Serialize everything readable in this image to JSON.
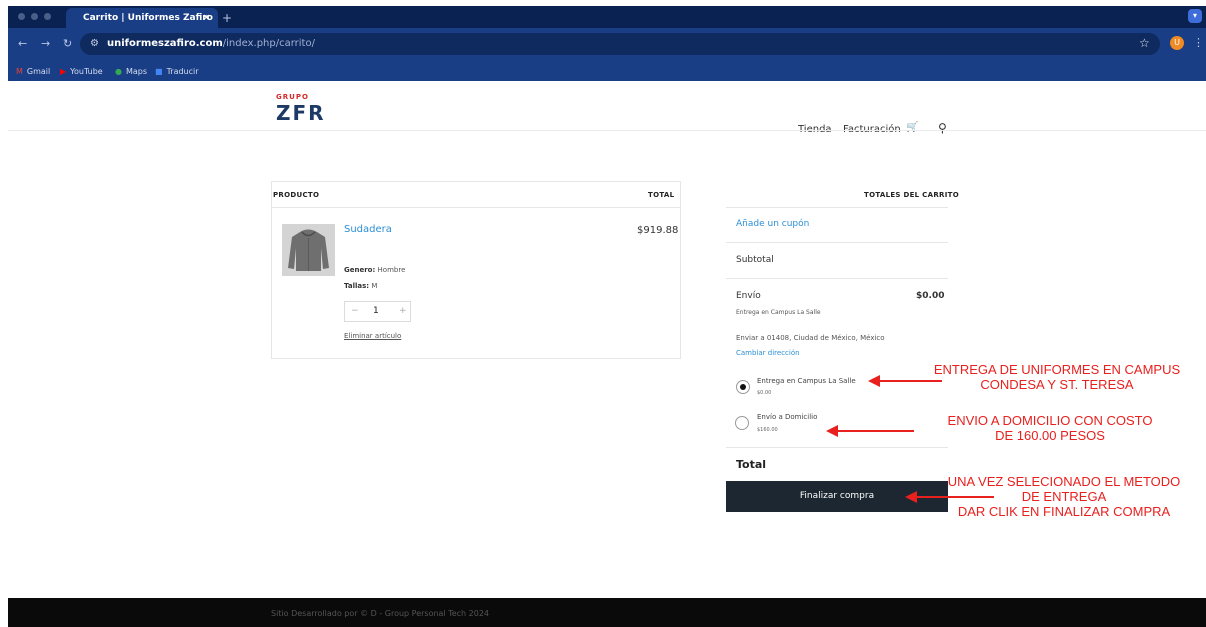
{
  "browser": {
    "tab_title": "Carrito | Uniformes Zafiro",
    "tab_close": "×",
    "new_tab": "+",
    "url_host": "uniformeszafiro.com",
    "url_path": "/index.php/carrito/",
    "profile_initial": "U",
    "bookmarks": [
      {
        "label": "Gmail",
        "icon": "gmail-icon"
      },
      {
        "label": "YouTube",
        "icon": "youtube-icon"
      },
      {
        "label": "Maps",
        "icon": "maps-icon"
      },
      {
        "label": "Traducir",
        "icon": "translate-icon"
      }
    ]
  },
  "site": {
    "logo_top": "GRUPO",
    "logo_main": "ZFR",
    "nav": [
      "Tienda",
      "Facturación"
    ]
  },
  "cart": {
    "col_product": "PRODUCTO",
    "col_total": "TOTAL",
    "item": {
      "name": "Sudadera",
      "price": "$919.88",
      "genero_label": "Genero:",
      "genero_value": "Hombre",
      "tallas_label": "Tallas:",
      "tallas_value": "M",
      "qty": "1",
      "minus": "−",
      "plus": "+",
      "remove": "Eliminar artículo"
    }
  },
  "totals": {
    "title": "TOTALES DEL CARRITO",
    "coupon": "Añade un cupón",
    "subtotal": "Subtotal",
    "envio": "Envío",
    "envio_amount": "$0.00",
    "envio_desc": "Entrega en Campus La Salle",
    "ship_to": "Enviar a 01408, Ciudad de México, México",
    "change_address": "Cambiar dirección",
    "options": [
      {
        "label": "Entrega en Campus La Salle",
        "price": "$0.00",
        "selected": true
      },
      {
        "label": "Envío a Domicilio",
        "price": "$160.00",
        "selected": false
      }
    ],
    "total": "Total",
    "finalize": "Finalizar compra"
  },
  "annotations": {
    "note1_line1": "ENTREGA DE UNIFORMES EN CAMPUS",
    "note1_line2": "CONDESA Y ST. TERESA",
    "note2_line1": "ENVIO A DOMICILIO CON COSTO",
    "note2_line2": "DE 160.00 PESOS",
    "note3_line1": "UNA VEZ SELECIONADO EL METODO",
    "note3_line2": "DE ENTREGA",
    "note3_line3": "DAR CLIK EN FINALIZAR COMPRA"
  },
  "footer": {
    "text": "Sitio Desarrollado por © D - Group Personal Tech 2024"
  },
  "colors": {
    "chrome_dark": "#0a2252",
    "chrome": "#1a3e85",
    "link": "#2d8fd5",
    "button": "#1c2731",
    "annotation": "#e8201e"
  }
}
